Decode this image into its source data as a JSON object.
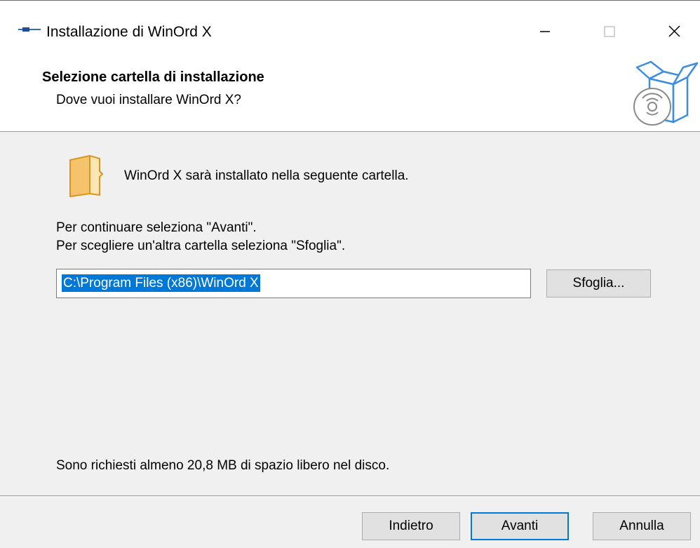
{
  "window": {
    "title": "Installazione di WinOrd X",
    "app_icon": "app-icon",
    "controls": [
      "minimize-icon",
      "maximize-icon",
      "close-icon"
    ]
  },
  "header": {
    "title": "Selezione cartella di installazione",
    "subtitle": "Dove vuoi installare WinOrd X?",
    "icon": "setup-box-cd-icon"
  },
  "body": {
    "folder_icon": "folder-icon",
    "folder_text": "WinOrd X sarà installato nella seguente cartella.",
    "instruction_1": "Per continuare seleziona \"Avanti\".",
    "instruction_2": "Per scegliere un'altra cartella seleziona \"Sfoglia\".",
    "install_path": "C:\\Program Files (x86)\\WinOrd X",
    "browse_label": "Sfoglia...",
    "space_required": "Sono richiesti almeno 20,8 MB di spazio libero nel disco."
  },
  "footer": {
    "back_label": "Indietro",
    "next_label": "Avanti",
    "cancel_label": "Annulla"
  },
  "colors": {
    "selection": "#0078d7",
    "dialog_bg": "#f0f0f0",
    "folder": "#f5c36b",
    "box_icon": "#3d8ee0"
  }
}
